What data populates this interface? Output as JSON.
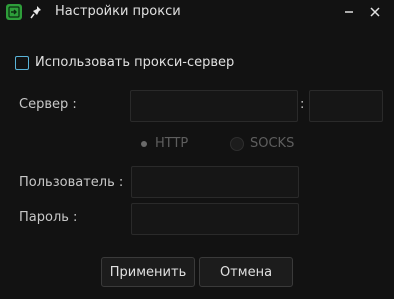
{
  "window": {
    "title": "Настройки прокси",
    "accent": "#2e9e3a"
  },
  "proxy": {
    "use_label": "Использовать прокси-сервер",
    "use_checked": false
  },
  "server": {
    "label": "Сервер :",
    "host_value": "",
    "colon": ":",
    "port_value": ""
  },
  "protocol": {
    "http_label": "HTTP",
    "socks_label": "SOCKS",
    "selected": "HTTP"
  },
  "user": {
    "label": "Пользователь :",
    "value": ""
  },
  "password": {
    "label": "Пароль :",
    "value": ""
  },
  "buttons": {
    "apply": "Применить",
    "cancel": "Отмена"
  },
  "colors": {
    "background": "#121212",
    "checkbox_border": "#5ab4d8",
    "field_bg": "#161616",
    "disabled_text": "#5e5e5e"
  }
}
